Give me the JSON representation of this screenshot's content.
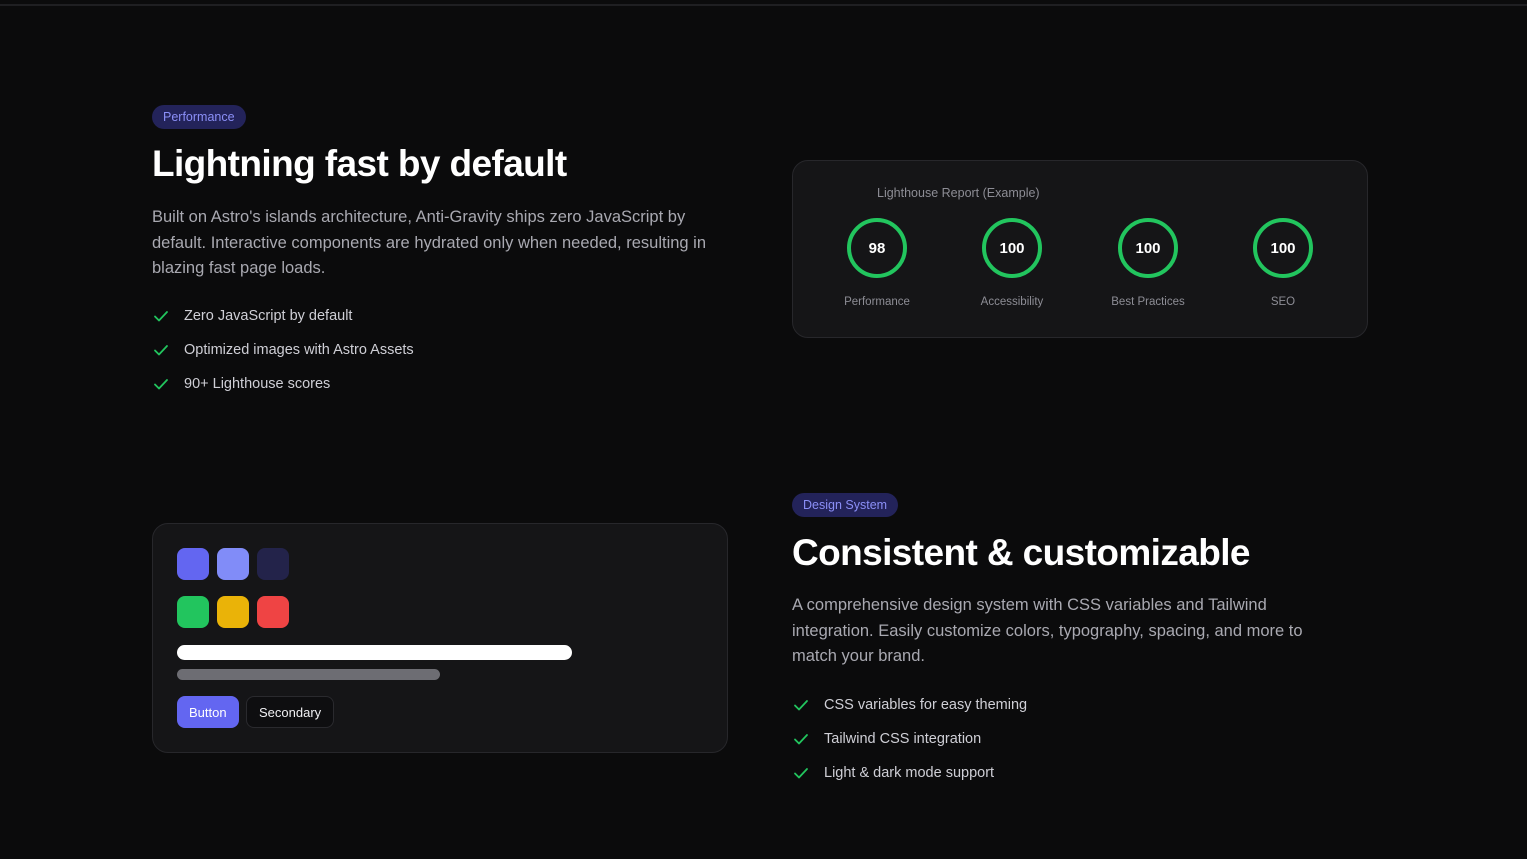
{
  "performance": {
    "badge": "Performance",
    "title": "Lightning fast by default",
    "description": "Built on Astro's islands architecture, Anti-Gravity ships zero JavaScript by default. Interactive components are hydrated only when needed, resulting in blazing fast page loads.",
    "features": [
      "Zero JavaScript by default",
      "Optimized images with Astro Assets",
      "90+ Lighthouse scores"
    ]
  },
  "lighthouse": {
    "title": "Lighthouse Report (Example)",
    "scores": [
      {
        "value": "98",
        "label": "Performance"
      },
      {
        "value": "100",
        "label": "Accessibility"
      },
      {
        "value": "100",
        "label": "Best Practices"
      },
      {
        "value": "100",
        "label": "SEO"
      }
    ]
  },
  "design": {
    "badge": "Design System",
    "title": "Consistent & customizable",
    "description": "A comprehensive design system with CSS variables and Tailwind integration. Easily customize colors, typography, spacing, and more to match your brand.",
    "features": [
      "CSS variables for easy theming",
      "Tailwind CSS integration",
      "Light & dark mode support"
    ],
    "preview": {
      "swatches": [
        "#6366f1",
        "#818cf8",
        "#23234a",
        "#22c55e",
        "#eab308",
        "#ef4444"
      ],
      "primary_button": "Button",
      "secondary_button": "Secondary"
    }
  },
  "colors": {
    "accent": "#6366f1",
    "success": "#22c55e",
    "background": "#0b0b0c",
    "card": "#151517"
  },
  "icons": {
    "feature_check": "check-icon"
  }
}
